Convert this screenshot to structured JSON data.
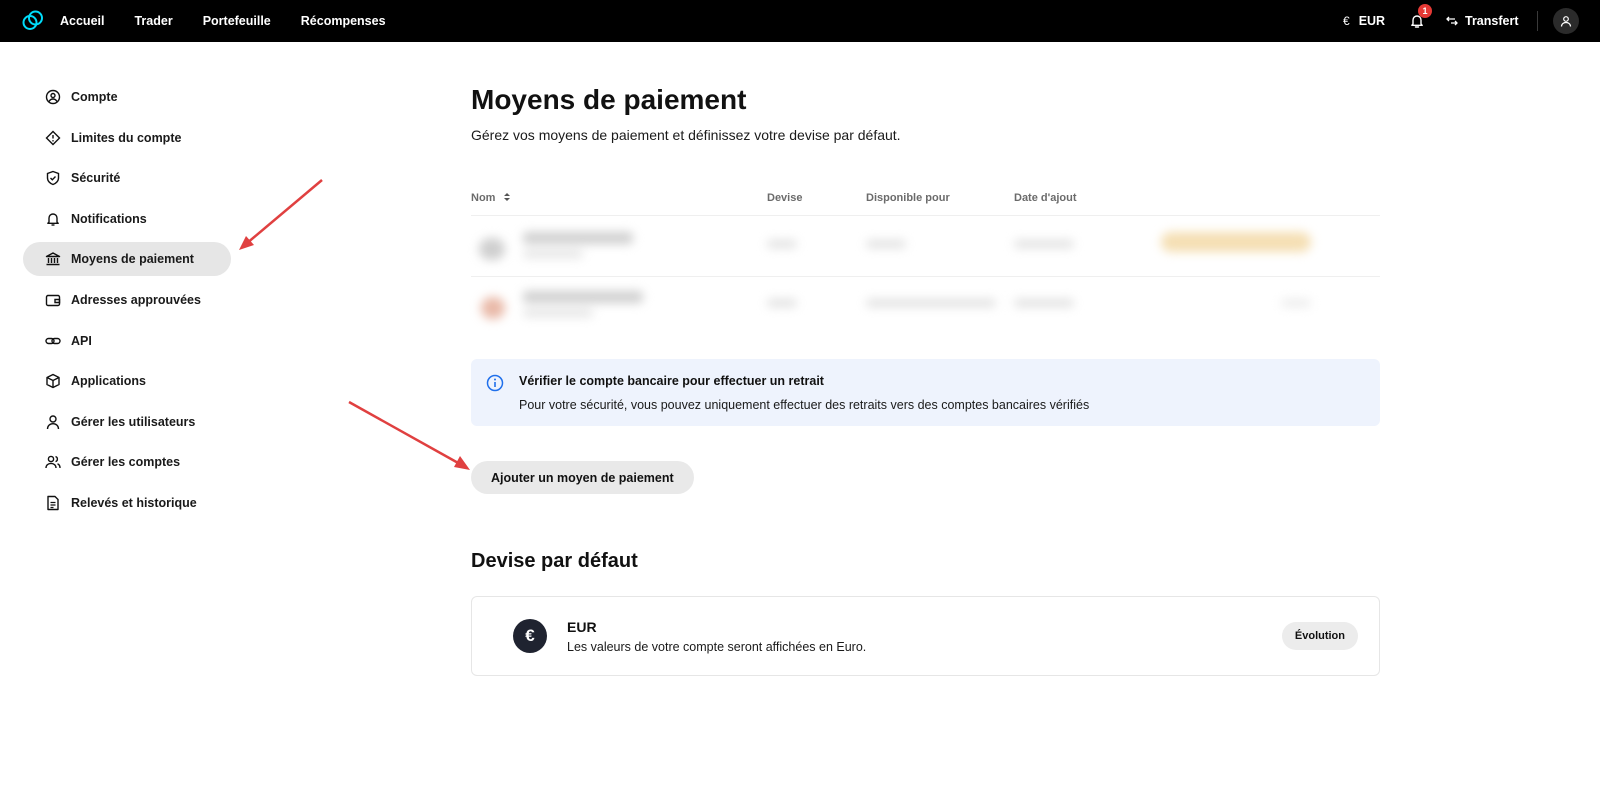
{
  "topbar": {
    "nav": [
      "Accueil",
      "Trader",
      "Portefeuille",
      "Récompenses"
    ],
    "currency_symbol": "€",
    "currency": "EUR",
    "notification_count": "1",
    "transfer_label": "Transfert"
  },
  "sidebar": {
    "items": [
      {
        "label": "Compte",
        "icon": "user-circle-icon"
      },
      {
        "label": "Limites du compte",
        "icon": "diamond-alert-icon"
      },
      {
        "label": "Sécurité",
        "icon": "shield-check-icon"
      },
      {
        "label": "Notifications",
        "icon": "bell-icon"
      },
      {
        "label": "Moyens de paiement",
        "icon": "bank-icon",
        "active": true
      },
      {
        "label": "Adresses approuvées",
        "icon": "wallet-icon"
      },
      {
        "label": "API",
        "icon": "link-icon"
      },
      {
        "label": "Applications",
        "icon": "cube-icon"
      },
      {
        "label": "Gérer les utilisateurs",
        "icon": "user-icon"
      },
      {
        "label": "Gérer les comptes",
        "icon": "users-icon"
      },
      {
        "label": "Relevés et historique",
        "icon": "document-icon"
      }
    ]
  },
  "main": {
    "title": "Moyens de paiement",
    "subtitle": "Gérez vos moyens de paiement et définissez votre devise par défaut.",
    "table_headers": {
      "name": "Nom",
      "currency": "Devise",
      "available": "Disponible pour",
      "date": "Date d'ajout"
    },
    "info": {
      "title": "Vérifier le compte bancaire pour effectuer un retrait",
      "text": "Pour votre sécurité, vous pouvez uniquement effectuer des retraits vers des comptes bancaires vérifiés"
    },
    "add_button": "Ajouter un moyen de paiement",
    "default_currency": {
      "section_title": "Devise par défaut",
      "symbol": "€",
      "code": "EUR",
      "description": "Les valeurs de votre compte seront affichées en Euro.",
      "button": "Évolution"
    }
  },
  "colors": {
    "topbar": "#000000",
    "accent_logo": "#00dcfa",
    "info_bg": "#eef3fd",
    "info_icon": "#1f6feb",
    "badge": "#e53935",
    "annotation_arrow": "#e04040"
  }
}
